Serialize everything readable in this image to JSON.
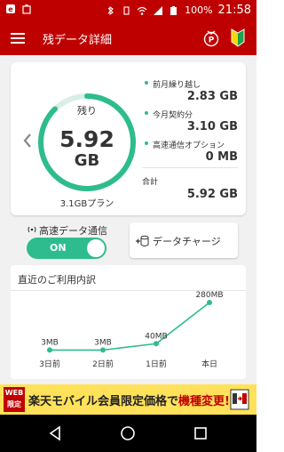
{
  "status": {
    "battery": "100%",
    "time": "21:58"
  },
  "header": {
    "title": "残データ詳細"
  },
  "remaining": {
    "label": "残り",
    "value": "5.92",
    "unit": "GB",
    "plan": "3.1GBプラン"
  },
  "breakdown": [
    {
      "label": "前月繰り越し",
      "value": "2.83 GB"
    },
    {
      "label": "今月契約分",
      "value": "3.10 GB"
    },
    {
      "label": "高速通信オプション",
      "value": "0 MB"
    }
  ],
  "total": {
    "label": "合計",
    "value": "5.92 GB"
  },
  "high_speed": {
    "label": "高速データ通信",
    "toggle_label": "ON"
  },
  "charge": {
    "label": "データチャージ"
  },
  "usage": {
    "title": "直近のご利用内訳",
    "days": [
      {
        "day": "3日前",
        "amount": "3MB",
        "mb": 3
      },
      {
        "day": "2日前",
        "amount": "3MB",
        "mb": 3
      },
      {
        "day": "1日前",
        "amount": "40MB",
        "mb": 40
      },
      {
        "day": "本日",
        "amount": "280MB",
        "mb": 280
      }
    ]
  },
  "banner": {
    "tag_line1": "WEB",
    "tag_line2": "限定",
    "text": "楽天モバイル会員限定価格で",
    "emphasis": "機種変更!"
  },
  "colors": {
    "brand_red": "#bf0000",
    "accent_green": "#2ebc8e",
    "ring_track": "#d7efe6"
  },
  "icons": {
    "menu": "hamburger-icon",
    "points": "medal-icon",
    "beginner": "beginner-mark-icon",
    "back": "chevron-left-icon"
  }
}
